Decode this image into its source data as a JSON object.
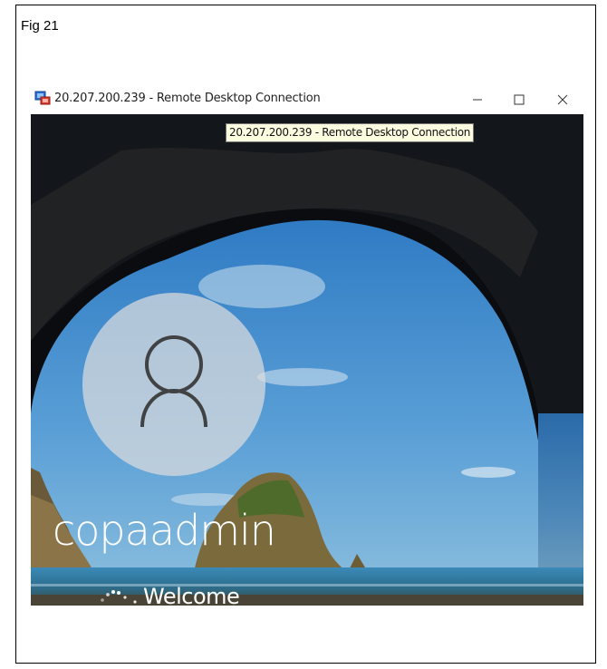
{
  "figure": {
    "label": "Fig 21"
  },
  "window": {
    "title": "20.207.200.239 - Remote Desktop Connection",
    "tooltip": "20.207.200.239 - Remote Desktop Connection",
    "icon": "remote-desktop-icon",
    "controls": {
      "minimize": "minimize-icon",
      "maximize": "maximize-icon",
      "close": "close-icon"
    }
  },
  "lock_screen": {
    "username": "copaadmin",
    "status": "Welcome",
    "avatar_icon": "user-icon",
    "spinner_icon": "loading-spinner-icon"
  }
}
